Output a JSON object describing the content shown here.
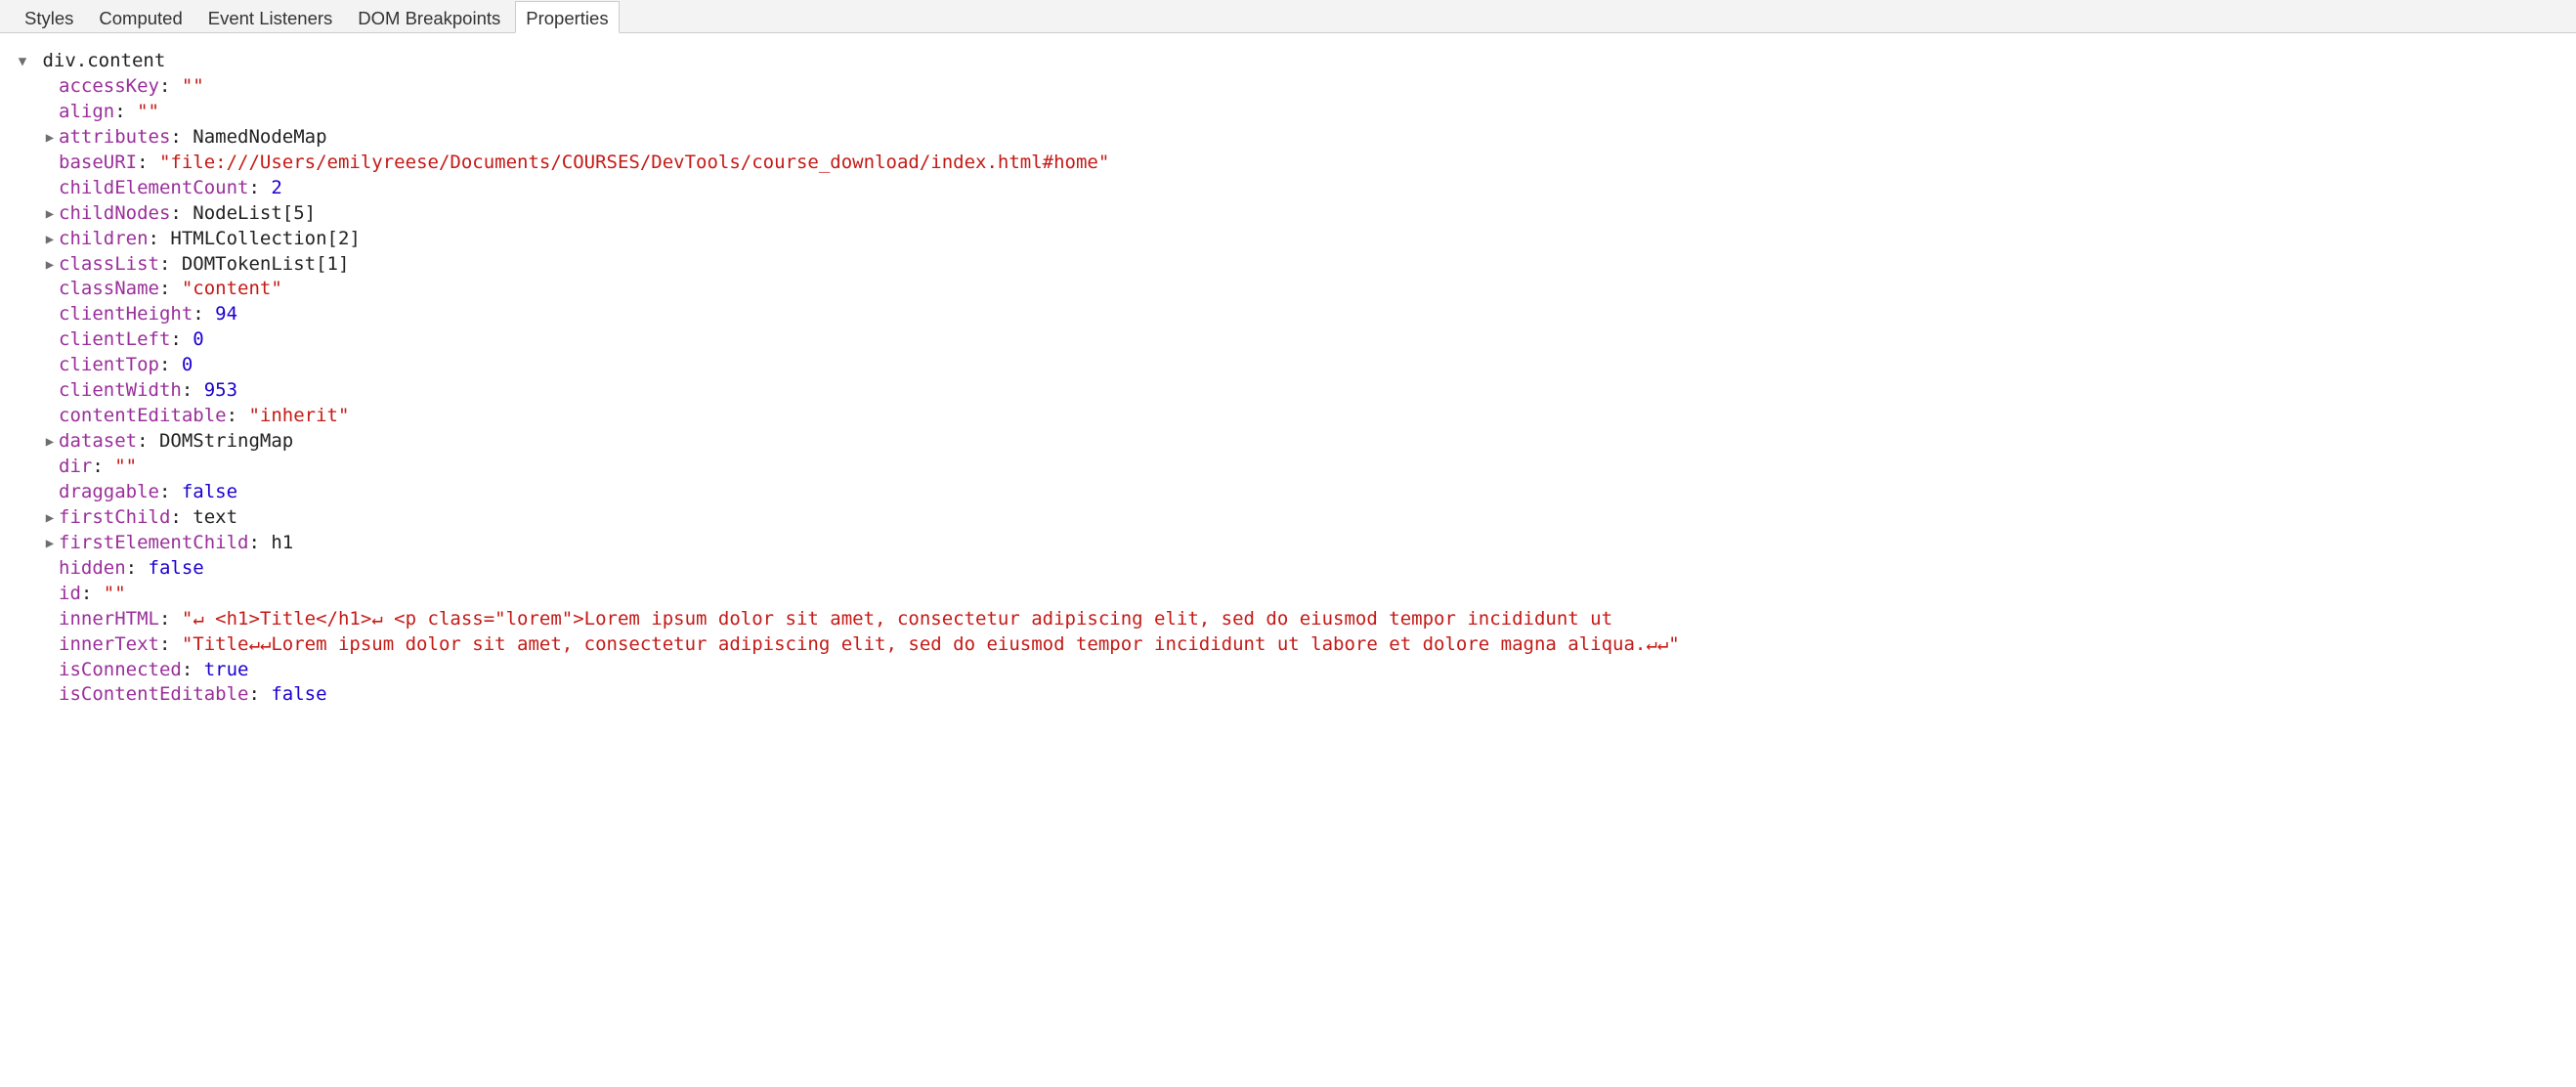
{
  "tabs": {
    "styles": "Styles",
    "computed": "Computed",
    "eventListeners": "Event Listeners",
    "domBreakpoints": "DOM Breakpoints",
    "properties": "Properties"
  },
  "header": {
    "label": "div.content"
  },
  "properties": [
    {
      "toggle": "none",
      "name": "accessKey",
      "valueKind": "string",
      "value": "\"\""
    },
    {
      "toggle": "none",
      "name": "align",
      "valueKind": "string",
      "value": "\"\""
    },
    {
      "toggle": "right",
      "name": "attributes",
      "valueKind": "type",
      "value": "NamedNodeMap"
    },
    {
      "toggle": "none",
      "name": "baseURI",
      "valueKind": "string",
      "value": "\"file:///Users/emilyreese/Documents/COURSES/DevTools/course_download/index.html#home\""
    },
    {
      "toggle": "none",
      "name": "childElementCount",
      "valueKind": "number",
      "value": "2"
    },
    {
      "toggle": "right",
      "name": "childNodes",
      "valueKind": "type",
      "value": "NodeList[5]"
    },
    {
      "toggle": "right",
      "name": "children",
      "valueKind": "type",
      "value": "HTMLCollection[2]"
    },
    {
      "toggle": "right",
      "name": "classList",
      "valueKind": "type",
      "value": "DOMTokenList[1]"
    },
    {
      "toggle": "none",
      "name": "className",
      "valueKind": "string",
      "value": "\"content\""
    },
    {
      "toggle": "none",
      "name": "clientHeight",
      "valueKind": "number",
      "value": "94"
    },
    {
      "toggle": "none",
      "name": "clientLeft",
      "valueKind": "number",
      "value": "0"
    },
    {
      "toggle": "none",
      "name": "clientTop",
      "valueKind": "number",
      "value": "0"
    },
    {
      "toggle": "none",
      "name": "clientWidth",
      "valueKind": "number",
      "value": "953"
    },
    {
      "toggle": "none",
      "name": "contentEditable",
      "valueKind": "string",
      "value": "\"inherit\""
    },
    {
      "toggle": "right",
      "name": "dataset",
      "valueKind": "type",
      "value": "DOMStringMap"
    },
    {
      "toggle": "none",
      "name": "dir",
      "valueKind": "string",
      "value": "\"\""
    },
    {
      "toggle": "none",
      "name": "draggable",
      "valueKind": "bool",
      "value": "false"
    },
    {
      "toggle": "right",
      "name": "firstChild",
      "valueKind": "type",
      "value": "text"
    },
    {
      "toggle": "right",
      "name": "firstElementChild",
      "valueKind": "type",
      "value": "h1"
    },
    {
      "toggle": "none",
      "name": "hidden",
      "valueKind": "bool",
      "value": "false"
    },
    {
      "toggle": "none",
      "name": "id",
      "valueKind": "string",
      "value": "\"\""
    },
    {
      "toggle": "none",
      "name": "innerHTML",
      "valueKind": "string",
      "value": "\"↵            <h1>Title</h1>↵            <p class=\"lorem\">Lorem ipsum dolor sit amet, consectetur adipiscing elit, sed do eiusmod tempor incididunt ut"
    },
    {
      "toggle": "none",
      "name": "innerText",
      "valueKind": "string",
      "value": "\"Title↵↵Lorem ipsum dolor sit amet, consectetur adipiscing elit, sed do eiusmod tempor incididunt ut labore et dolore magna aliqua.↵↵\""
    },
    {
      "toggle": "none",
      "name": "isConnected",
      "valueKind": "bool",
      "value": "true"
    },
    {
      "toggle": "none",
      "name": "isContentEditable",
      "valueKind": "bool",
      "value": "false"
    }
  ]
}
